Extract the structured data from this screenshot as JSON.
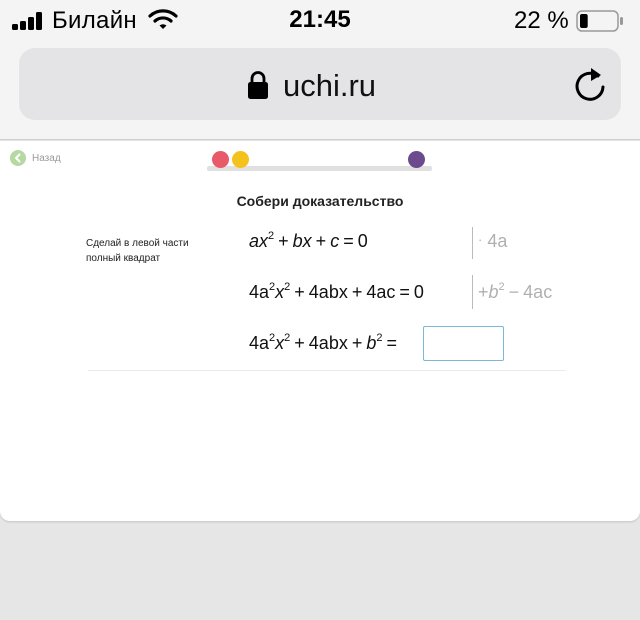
{
  "status_bar": {
    "carrier": "Билайн",
    "time": "21:45",
    "battery_percent": "22 %",
    "battery_level": 0.22
  },
  "browser": {
    "domain": "uchi.ru"
  },
  "lesson": {
    "back_label": "Назад",
    "progress_dots": [
      {
        "color": "#e85a6a",
        "state": "done"
      },
      {
        "color": "#f5c21b",
        "state": "current"
      },
      {
        "color": "#6b4b8e",
        "state": "final"
      }
    ],
    "title": "Собери доказательство",
    "hint": "Сделай в левой части полный квадрат",
    "answer_value": ""
  },
  "equations": {
    "row1": {
      "t1": "ax",
      "e1": "2",
      "p1": "+",
      "t2": "bx",
      "p2": "+",
      "t3": "c",
      "eq": "=",
      "rhs": "0",
      "side_op": "·",
      "side_val": "4a"
    },
    "row2": {
      "c1": "4a",
      "e1": "2",
      "t1": "x",
      "e2": "2",
      "p1": "+",
      "t2": "4abx",
      "p2": "+",
      "t3": "4ac",
      "eq": "=",
      "rhs": "0",
      "side_op": "+",
      "side_b": "b",
      "side_e": "2",
      "side_minus": "−",
      "side_val": "4ac"
    },
    "row3": {
      "c1": "4a",
      "e1": "2",
      "t1": "x",
      "e2": "2",
      "p1": "+",
      "t2": "4abx",
      "p2": "+",
      "t3": "b",
      "e3": "2",
      "eq": "="
    }
  },
  "colors": {
    "back_icon": "#b6d9a4",
    "input_border": "#79b8d6",
    "side_text": "#b0b0b0"
  }
}
